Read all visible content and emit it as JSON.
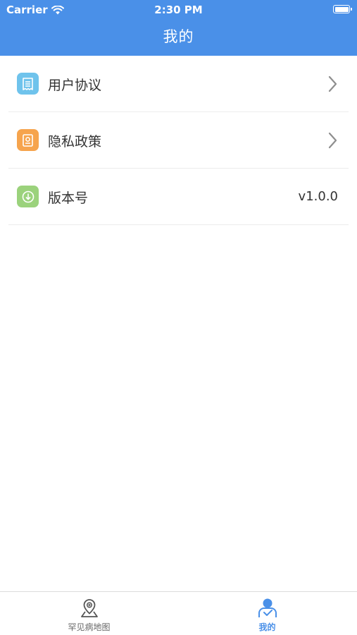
{
  "status_bar": {
    "carrier": "Carrier",
    "time": "2:30 PM"
  },
  "nav": {
    "title": "我的"
  },
  "menu": [
    {
      "label": "用户协议",
      "icon": "document-icon",
      "color": "#6fc3ec"
    },
    {
      "label": "隐私政策",
      "icon": "privacy-document-icon",
      "color": "#f6a44d"
    },
    {
      "label": "版本号",
      "icon": "download-icon",
      "color": "#9bd27c",
      "value": "v1.0.0"
    }
  ],
  "tabbar": [
    {
      "label": "罕见病地图",
      "icon": "map-pin-icon",
      "active": false
    },
    {
      "label": "我的",
      "icon": "user-icon",
      "active": true
    }
  ],
  "colors": {
    "accent": "#4a90e8",
    "divider": "#ececec"
  }
}
